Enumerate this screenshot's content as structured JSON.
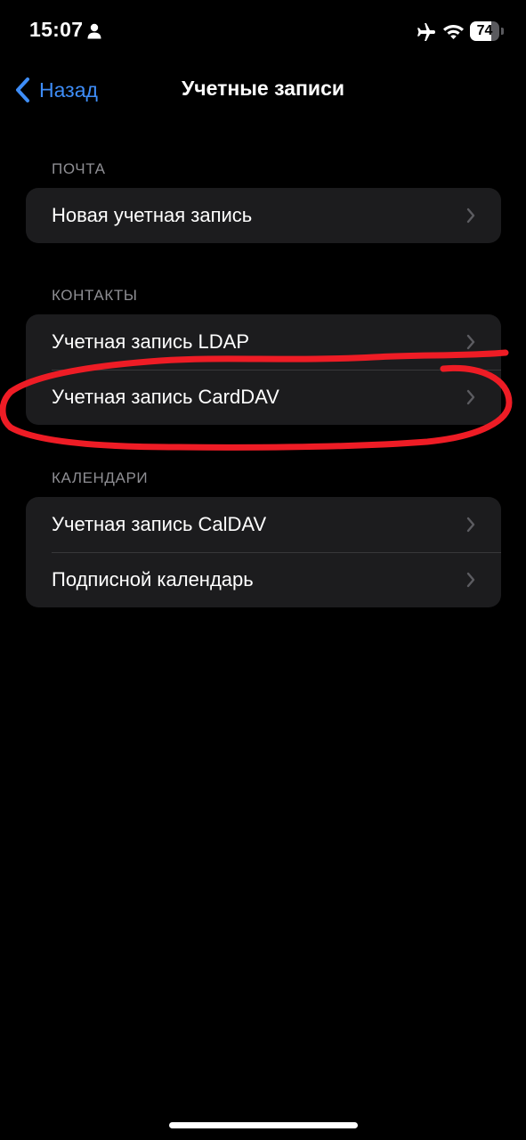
{
  "status_bar": {
    "time": "15:07",
    "battery_level": "74",
    "battery_fraction": 0.74,
    "icons": [
      "person-icon",
      "airplane-icon",
      "wifi-icon",
      "battery-icon"
    ]
  },
  "nav": {
    "back_label": "Назад",
    "title": "Учетные записи"
  },
  "sections": {
    "mail": {
      "header": "ПОЧТА",
      "rows": [
        {
          "label": "Новая учетная запись"
        }
      ]
    },
    "contacts": {
      "header": "КОНТАКТЫ",
      "rows": [
        {
          "label": "Учетная запись LDAP"
        },
        {
          "label": "Учетная запись CardDAV"
        }
      ]
    },
    "calendars": {
      "header": "КАЛЕНДАРИ",
      "rows": [
        {
          "label": "Учетная запись CalDAV"
        },
        {
          "label": "Подписной календарь"
        }
      ]
    }
  },
  "colors": {
    "background": "#000000",
    "group_background": "#1c1c1e",
    "accent": "#3e8df7",
    "annotation": "#ee1c25"
  }
}
